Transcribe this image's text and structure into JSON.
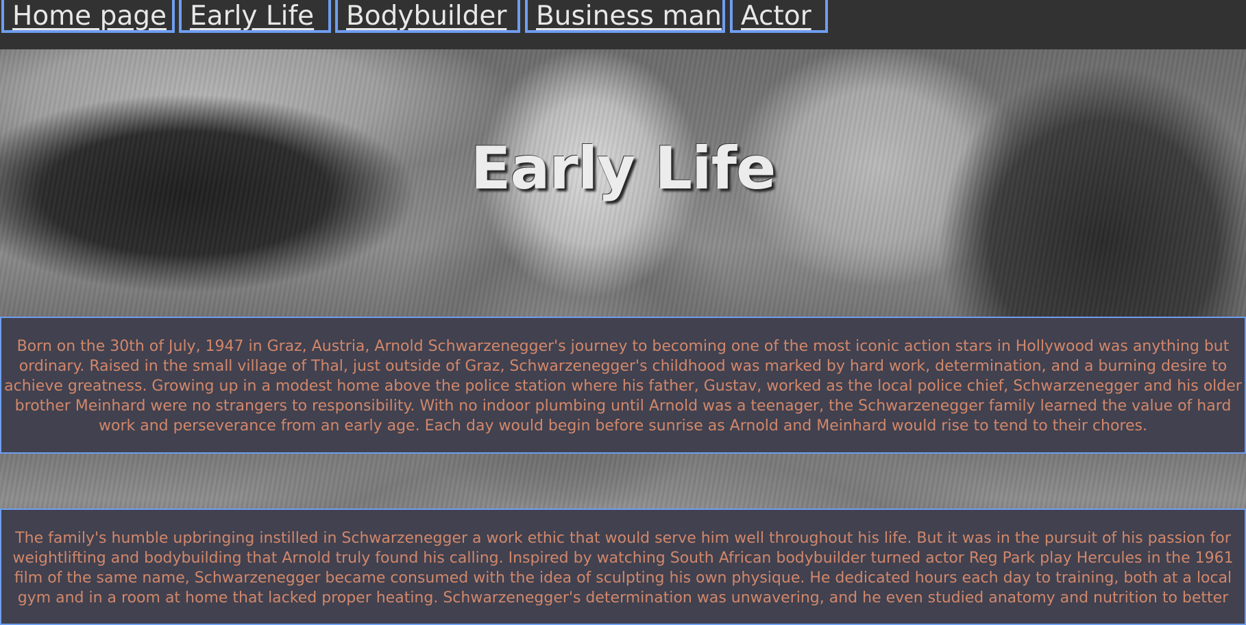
{
  "nav": {
    "items": [
      {
        "label": "Home page"
      },
      {
        "label": "Early Life"
      },
      {
        "label": "Bodybuilder"
      },
      {
        "label": "Business man"
      },
      {
        "label": "Actor"
      }
    ]
  },
  "hero": {
    "title": "Early Life"
  },
  "sections": [
    {
      "text": "Born on the 30th of July, 1947 in Graz, Austria, Arnold Schwarzenegger's journey to becoming one of the most iconic action stars in Hollywood was anything but ordinary. Raised in the small village of Thal, just outside of Graz, Schwarzenegger's childhood was marked by hard work, determination, and a burning desire to achieve greatness. Growing up in a modest home above the police station where his father, Gustav, worked as the local police chief, Schwarzenegger and his older brother Meinhard were no strangers to responsibility. With no indoor plumbing until Arnold was a teenager, the Schwarzenegger family learned the value of hard work and perseverance from an early age. Each day would begin before sunrise as Arnold and Meinhard would rise to tend to their chores."
    },
    {
      "text": "The family's humble upbringing instilled in Schwarzenegger a work ethic that would serve him well throughout his life. But it was in the pursuit of his passion for weightlifting and bodybuilding that Arnold truly found his calling. Inspired by watching South African bodybuilder turned actor Reg Park play Hercules in the 1961 film of the same name, Schwarzenegger became consumed with the idea of sculpting his own physique. He dedicated hours each day to training, both at a local gym and in a room at home that lacked proper heating. Schwarzenegger's determination was unwavering, and he even studied anatomy and nutrition to better"
    }
  ],
  "colors": {
    "nav_border": "#6f9ef0",
    "panel_bg": "#41414f",
    "panel_text": "#d2876a",
    "nav_bg": "#323232"
  }
}
